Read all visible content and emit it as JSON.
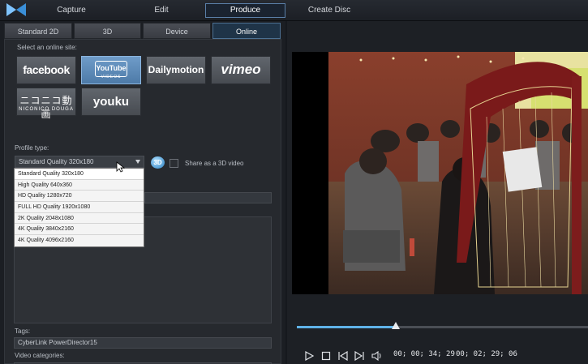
{
  "app": {
    "logo_icon": "cyberlink-logo-icon"
  },
  "top_tabs": {
    "capture": "Capture",
    "edit": "Edit",
    "produce": "Produce",
    "create_disc": "Create Disc"
  },
  "sub_tabs": {
    "standard_2d": "Standard 2D",
    "three_d": "3D",
    "device": "Device",
    "online": "Online"
  },
  "online": {
    "select_label": "Select an online site:",
    "sites": {
      "facebook": "facebook",
      "youtube": "YouTube",
      "youtube_sub": "VIDEOS",
      "dailymotion": "Dailymotion",
      "vimeo": "vimeo",
      "niconico": "ニコニコ動画",
      "niconico_sub": "NICONICO DOUGA",
      "youku": "youku"
    }
  },
  "profile": {
    "label": "Profile type:",
    "selected": "Standard Quality 320x180",
    "options": [
      "Standard Quality 320x180",
      "High Quality 640x360",
      "HD Quality 1280x720",
      "FULL HD Quality 1920x1080",
      "2K Quality 2048x1080",
      "4K Quality 3840x2160",
      "4K Quality 4096x2160"
    ]
  },
  "share_3d": {
    "badge": "3D",
    "label": "Share as a 3D video",
    "checked": false
  },
  "tags": {
    "label": "Tags:",
    "value": "CyberLink PowerDirector15"
  },
  "video_categories": {
    "label": "Video categories:",
    "value": "---"
  },
  "player": {
    "current_time": "00; 00; 34; 29",
    "total_time": "00; 02; 29; 06",
    "progress_fraction": 0.34
  },
  "colors": {
    "accent": "#5fb2e8",
    "produce_tab_border": "#5a7fa8"
  }
}
